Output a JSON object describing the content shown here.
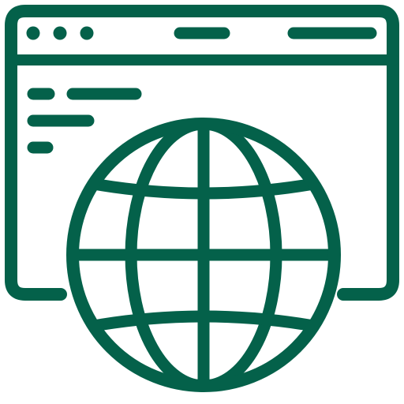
{
  "icon": {
    "name": "web-browser-globe-icon",
    "stroke_color": "#04614a",
    "background": "#ffffff"
  },
  "browser_window": {
    "icon": "browser-window-icon",
    "title_bar": {
      "dots_count": 3,
      "dot_icon": "window-control-dot-icon",
      "bar_icon": "title-bar-line-icon"
    },
    "content": {
      "text_lines_icon": "text-line-icon"
    }
  },
  "globe": {
    "icon": "globe-icon"
  }
}
